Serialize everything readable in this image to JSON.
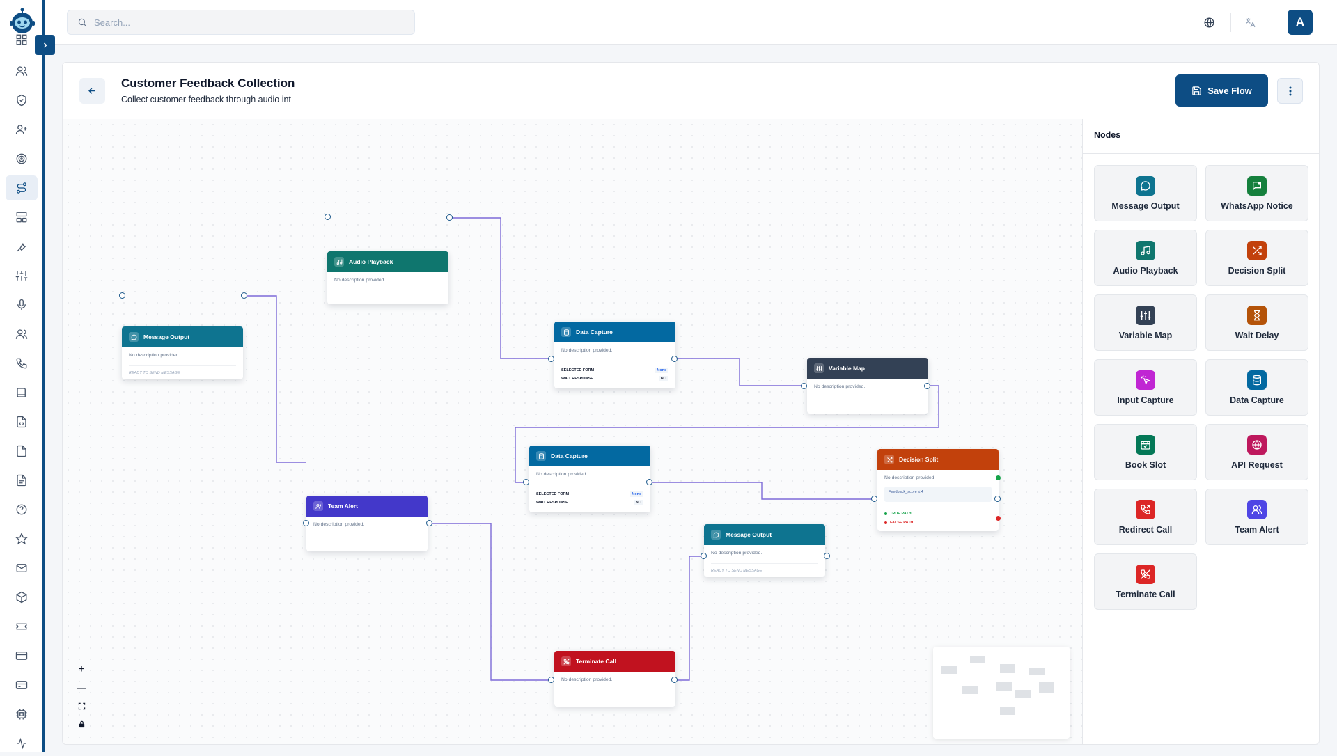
{
  "topbar": {
    "search_placeholder": "Search...",
    "avatar_initial": "A"
  },
  "flow": {
    "title": "Customer Feedback Collection",
    "description": "Collect customer feedback through audio int",
    "save_label": "Save Flow"
  },
  "canvas": {
    "nodes": [
      {
        "id": "message-output-1",
        "type": "Message Output",
        "description": "No description provided.",
        "status": "READY TO SEND MESSAGE"
      },
      {
        "id": "audio-playback-1",
        "type": "Audio Playback",
        "description": "No description provided."
      },
      {
        "id": "data-capture-1",
        "type": "Data Capture",
        "description": "No description provided.",
        "rows": [
          {
            "label": "SELECTED FORM",
            "value": "None"
          },
          {
            "label": "WAIT RESPONSE",
            "value": "NO"
          }
        ]
      },
      {
        "id": "variable-map-1",
        "type": "Variable Map",
        "description": "No description provided."
      },
      {
        "id": "data-capture-2",
        "type": "Data Capture",
        "description": "No description provided.",
        "rows": [
          {
            "label": "SELECTED FORM",
            "value": "None"
          },
          {
            "label": "WAIT RESPONSE",
            "value": "NO"
          }
        ]
      },
      {
        "id": "decision-split-1",
        "type": "Decision Split",
        "description": "No description provided.",
        "condition": "Feedback_score ≤ 4",
        "true_label": "TRUE PATH",
        "false_label": "FALSE PATH"
      },
      {
        "id": "team-alert-1",
        "type": "Team Alert",
        "description": "No description provided."
      },
      {
        "id": "message-output-2",
        "type": "Message Output",
        "description": "No description provided.",
        "status": "READY TO SEND MESSAGE"
      },
      {
        "id": "terminate-call-1",
        "type": "Terminate Call",
        "description": "No description provided."
      }
    ],
    "controls": {
      "zoom_in": "+",
      "zoom_out": "—"
    }
  },
  "palette": {
    "title": "Nodes",
    "items": [
      {
        "label": "Message Output",
        "icon": "message-circle-icon",
        "color": "#0e7490"
      },
      {
        "label": "WhatsApp Notice",
        "icon": "whatsapp-message-icon",
        "color": "#15803d"
      },
      {
        "label": "Audio Playback",
        "icon": "music-note-icon",
        "color": "#0f766e"
      },
      {
        "label": "Decision Split",
        "icon": "shuffle-icon",
        "color": "#c2410c"
      },
      {
        "label": "Variable Map",
        "icon": "sliders-icon",
        "color": "#334155"
      },
      {
        "label": "Wait Delay",
        "icon": "hourglass-icon",
        "color": "#b45309"
      },
      {
        "label": "Input Capture",
        "icon": "cursor-click-icon",
        "color": "#c026d3"
      },
      {
        "label": "Data Capture",
        "icon": "database-icon",
        "color": "#0369a1"
      },
      {
        "label": "Book Slot",
        "icon": "calendar-check-icon",
        "color": "#047857"
      },
      {
        "label": "API Request",
        "icon": "globe-icon",
        "color": "#be185d"
      },
      {
        "label": "Redirect Call",
        "icon": "phone-forward-icon",
        "color": "#dc2626"
      },
      {
        "label": "Team Alert",
        "icon": "users-icon",
        "color": "#4f46e5"
      },
      {
        "label": "Terminate Call",
        "icon": "phone-off-icon",
        "color": "#dc2626"
      }
    ]
  },
  "colors": {
    "brand": "#0d4d84",
    "edge": "#7c6bd8",
    "message_output": "#0e7490",
    "audio_playback": "#0f766e",
    "data_capture": "#0369a1",
    "variable_map": "#334155",
    "decision_split": "#c2410c",
    "team_alert": "#4338ca",
    "terminate_call": "#c1121f"
  }
}
